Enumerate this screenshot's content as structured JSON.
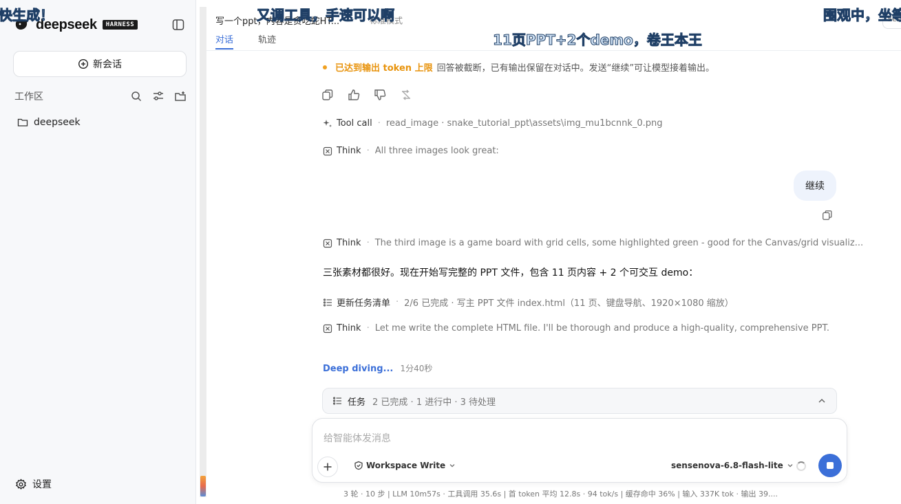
{
  "danmaku": [
    "快生成！",
    "又调工具，手速可以啊",
    "11页PPT+2个demo，卷王本王",
    "围观中，坐等"
  ],
  "sidebar": {
    "brand_name": "deepseek",
    "brand_badge": "HARNESS",
    "new_chat_label": "新会话",
    "workspace_label": "工作区",
    "folder_name": "deepseek",
    "settings_label": "设置"
  },
  "topbar": {
    "chat_title": "写一个ppt，内容是贪吃蛇HT...",
    "mode": "标准模式",
    "tabs": [
      "对话",
      "轨迹"
    ],
    "session_chip": "Sess"
  },
  "messages": {
    "warning_title": "已达到输出 token 上限",
    "warning_text": "回答被截断，已有输出保留在对话中。发送“继续”可让模型接着输出。",
    "tool_call_label": "Tool call",
    "tool_call_detail": "read_image · snake_tutorial_ppt\\assets\\img_mu1bcnnk_0.png",
    "think_label": "Think",
    "think1": "All three images look great:",
    "user_message": "继续",
    "think2": "The third image is a game board with grid cells, some highlighted green - good for the Canvas/grid visualiz...",
    "reply": "三张素材都很好。现在开始写完整的 PPT 文件，包含 11 页内容 + 2 个可交互 demo：",
    "task_update_label": "更新任务清单",
    "task_update_detail": "2/6 已完成 · 写主 PPT 文件 index.html（11 页、键盘导航、1920×1080 缩放）",
    "think3": "Let me write the complete HTML file. I'll be thorough and produce a high-quality, comprehensive PPT.",
    "deep_diving": "Deep diving...",
    "elapsed": "1分40秒"
  },
  "tasks": {
    "title": "任务",
    "info": "2 已完成 · 1 进行中 · 3 待处理"
  },
  "composer": {
    "placeholder": "给智能体发消息",
    "permission": "Workspace Write",
    "model": "sensenova-6.8-flash-lite"
  },
  "status_bar": "3 轮 · 10 步  |  LLM 10m57s · 工具调用 35.6s  |  首 token 平均 12.8s · 94 tok/s  |  缓存命中 36%  |  输入 337K tok · 输出 39....",
  "colors": {
    "accent": "#3b6fd8",
    "warning": "#e8930c"
  }
}
